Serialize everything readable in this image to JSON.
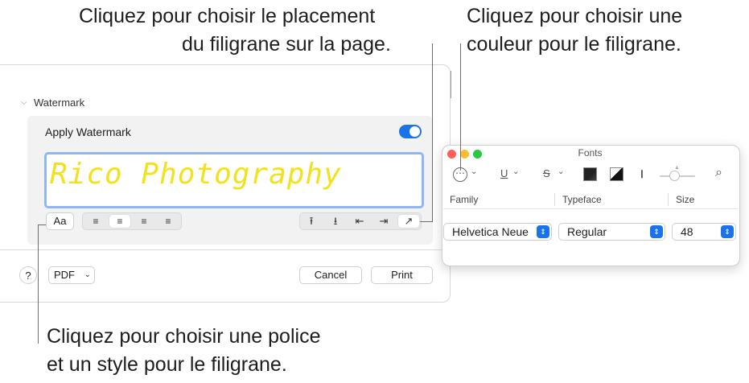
{
  "callouts": {
    "placement_line1": "Cliquez pour choisir le placement",
    "placement_line2": "du filigrane sur la page.",
    "color_line1": "Cliquez pour choisir une",
    "color_line2": "couleur pour le filigrane.",
    "font_line1": "Cliquez pour choisir une police",
    "font_line2": "et un style pour le filigrane."
  },
  "print_dialog": {
    "section_title": "Watermark",
    "apply_label": "Apply Watermark",
    "apply_enabled": true,
    "watermark_text": "Rico Photography",
    "watermark_color": "#f2e21e",
    "font_button_label": "Aa",
    "alignment_icons": [
      "align-left-icon",
      "align-center-icon",
      "align-right-icon",
      "align-justify-icon"
    ],
    "alignment_glyphs": [
      "≡",
      "≡",
      "≡",
      "≡"
    ],
    "selected_alignment": "align-center-icon",
    "placement_glyphs": [
      "⭱",
      "⭳",
      "⇤",
      "⇥",
      "↗"
    ],
    "help_label": "?",
    "pdf_label": "PDF",
    "cancel_label": "Cancel",
    "print_label": "Print"
  },
  "fonts_panel": {
    "title": "Fonts",
    "toolbar": {
      "more_glyph": "⋯",
      "underline_glyph": "U",
      "strike_glyph": "S",
      "spacing_glyph": "Ⅰ",
      "search_glyph": "⌕"
    },
    "columns": {
      "family": "Family",
      "typeface": "Typeface",
      "size": "Size"
    },
    "family_value": "Helvetica Neue",
    "typeface_value": "Regular",
    "size_value": "48",
    "accent_color": "#1a73e8"
  }
}
